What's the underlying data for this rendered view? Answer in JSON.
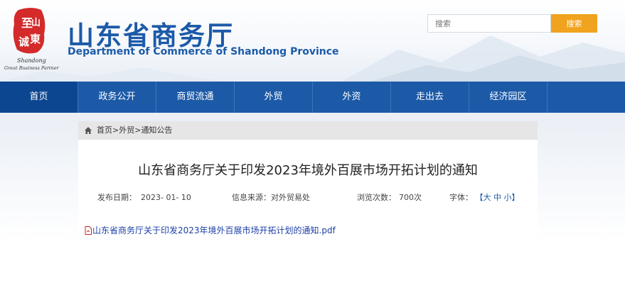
{
  "header": {
    "title_cn": "山东省商务厅",
    "title_en": "Department of Commerce of Shandong Province",
    "logo_text": "Shandong Great Business Partner",
    "search_placeholder": "搜索",
    "search_button": "搜索"
  },
  "nav": {
    "items": [
      {
        "label": "首页"
      },
      {
        "label": "政务公开"
      },
      {
        "label": "商贸流通"
      },
      {
        "label": "外贸"
      },
      {
        "label": "外资"
      },
      {
        "label": "走出去"
      },
      {
        "label": "经济园区"
      }
    ]
  },
  "breadcrumb": {
    "home": "首页",
    "sep1": ">",
    "section": "外贸",
    "sep2": ">",
    "current": "通知公告"
  },
  "article": {
    "title": "山东省商务厅关于印发2023年境外百展市场开拓计划的通知",
    "publish_label": "发布日期：",
    "publish_date": "2023- 01- 10",
    "source_label": "信息来源：",
    "source": "对外贸易处",
    "views_label": "浏览次数：",
    "views": "700次",
    "font_label": "字体：",
    "font_open": "【",
    "font_large": "大",
    "font_medium": "中",
    "font_small": "小",
    "font_close": "】",
    "attachment": "山东省商务厅关于印发2023年境外百展市场开拓计划的通知.pdf"
  },
  "colors": {
    "brand_blue": "#1c5aa8",
    "nav_active": "#0d4690",
    "search_orange": "#f0a31e",
    "logo_red": "#d42a2a"
  },
  "icons": [
    "home-icon",
    "pdf-icon",
    "logo-seal"
  ]
}
